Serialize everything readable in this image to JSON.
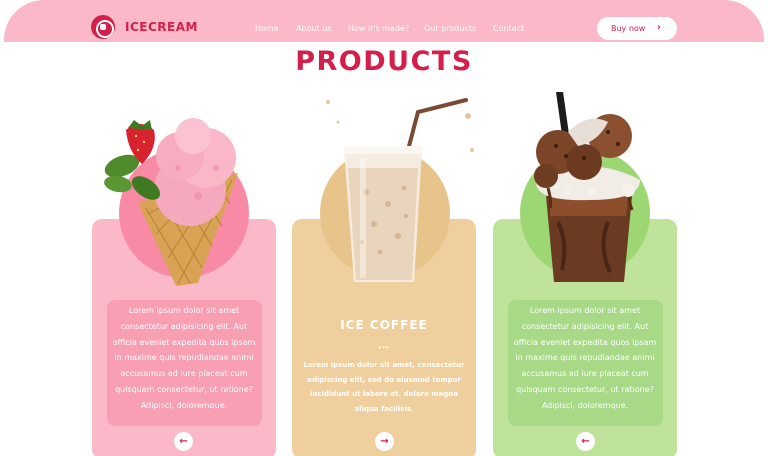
{
  "brand": {
    "name": "ICECREAM"
  },
  "nav": {
    "items": [
      "Home",
      "About us",
      "How it's made?",
      "Our products",
      "Contact"
    ]
  },
  "header": {
    "buy_label": "Buy now",
    "buy_icon": "chevron-right"
  },
  "page": {
    "title": "PRODUCTS"
  },
  "products": [
    {
      "image": "ice-cream-cone",
      "text": "Lorem ipsum dolor sit amet consectetur adipisicing elit. Aut officia eveniet expedita quos ipsam in maxime quis repudiandae animi accusamus ad iure placeat cum quisquam consectetur, ut ratione? Adipisci, doloremque.",
      "arrow": "←"
    },
    {
      "image": "iced-coffee-glass",
      "name": "ICE COFFEE",
      "dots": "•••",
      "text": "Lorem ipsum dolor sit amet, consectetur adipiscing elit, sed do eiusmod tempor incididunt ut labore et. dolore magna aliqua facilisis.",
      "arrow": "→"
    },
    {
      "image": "chocolate-milkshake",
      "text": "Lorem ipsum dolor sit amet consectetur adipisicing elit. Aut officia eveniet expedita quos ipsam in maxime quis repudiandae animi accusamus ad iure placeat cum quisquam consectetur, ut ratione? Adipisci, doloremque.",
      "arrow": "←"
    }
  ],
  "colors": {
    "brand": "#d51f4b",
    "header": "#fbb8c8",
    "card_pink": "#fbb8c8",
    "card_tan": "#f0cf9e",
    "card_green": "#bfe39a"
  }
}
